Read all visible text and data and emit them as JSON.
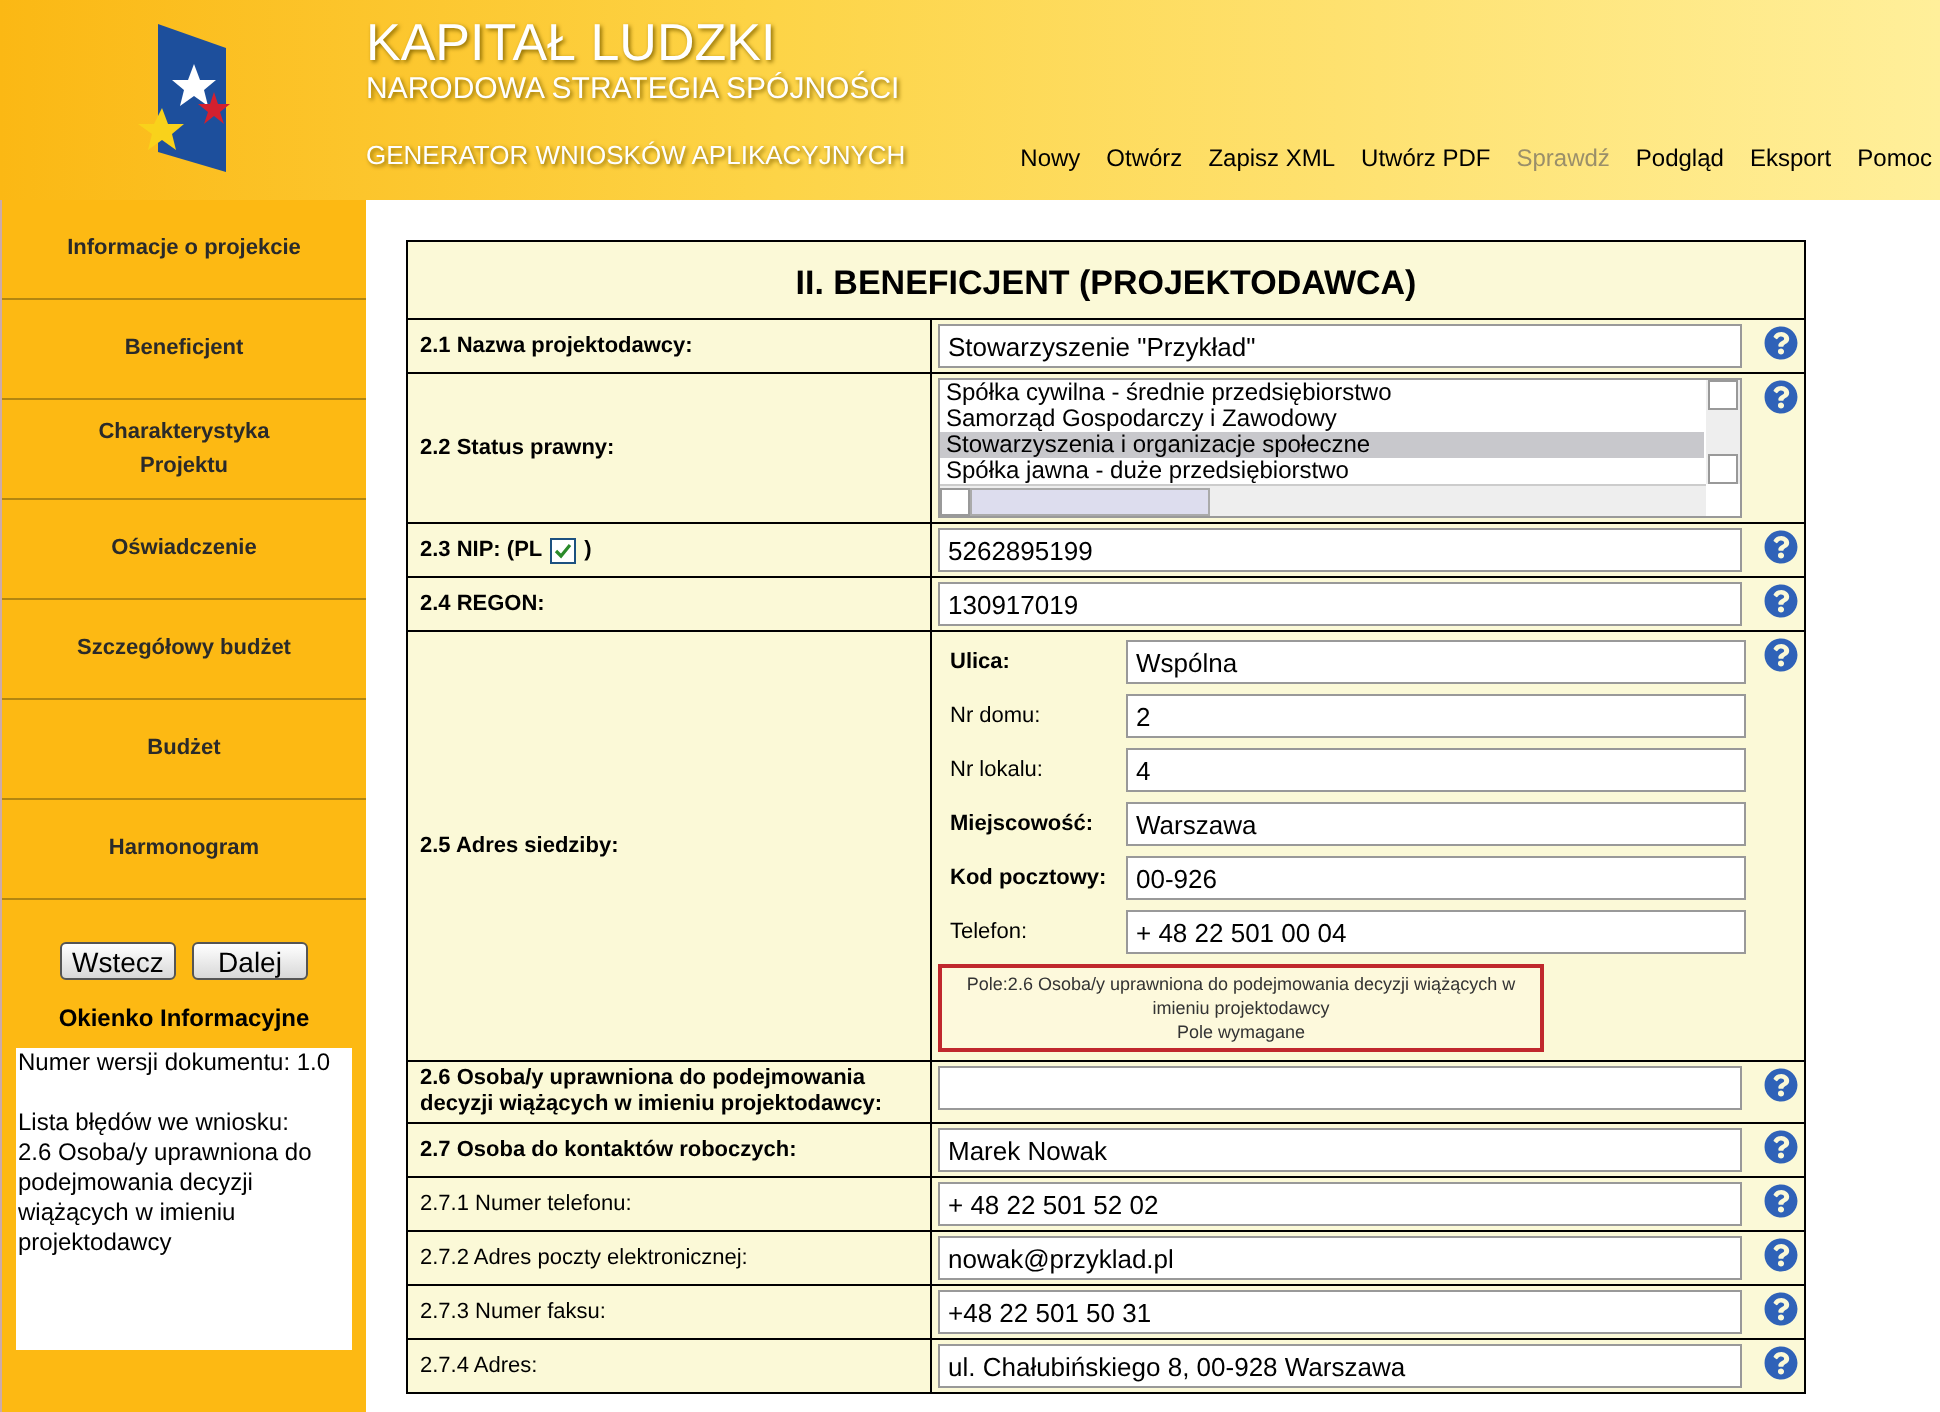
{
  "header": {
    "title": "KAPITAŁ LUDZKI",
    "subtitle": "NARODOWA STRATEGIA SPÓJNOŚCI",
    "generator": "GENERATOR WNIOSKÓW APLIKACYJNYCH",
    "menu": [
      {
        "label": "Nowy",
        "disabled": false
      },
      {
        "label": "Otwórz",
        "disabled": false
      },
      {
        "label": "Zapisz XML",
        "disabled": false
      },
      {
        "label": "Utwórz PDF",
        "disabled": false
      },
      {
        "label": "Sprawdź",
        "disabled": true
      },
      {
        "label": "Podgląd",
        "disabled": false
      },
      {
        "label": "Eksport",
        "disabled": false
      },
      {
        "label": "Pomoc",
        "disabled": false
      }
    ]
  },
  "sidebar": {
    "items": [
      "Informacje o projekcie",
      "Beneficjent",
      "Charakterystyka Projektu",
      "Oświadczenie",
      "Szczegółowy budżet",
      "Budżet",
      "Harmonogram"
    ],
    "buttons": [
      "Wstecz",
      "Dalej"
    ],
    "info_title": "Okienko Informacyjne",
    "info_paragraphs": [
      [
        "Numer wersji dokumentu: 1.0"
      ],
      [
        "Lista błędów we wniosku:",
        "2.6 Osoba/y uprawniona do podejmowania decyzji wiążących w imieniu projektodawcy"
      ]
    ]
  },
  "form": {
    "title": "II. BENEFICJENT (PROJEKTODAWCA)",
    "rows": [
      {
        "kind": "text",
        "label": "2.1 Nazwa projektodawcy:",
        "bold": true,
        "value": "Stowarzyszenie \"Przykład\""
      },
      {
        "kind": "listbox",
        "label": "2.2 Status prawny:",
        "bold": true,
        "options": [
          {
            "label": "Spółka cywilna - średnie przedsiębiorstwo",
            "selected": false
          },
          {
            "label": "Samorząd Gospodarczy i Zawodowy",
            "selected": false
          },
          {
            "label": "Stowarzyszenia i organizacje społeczne",
            "selected": true
          },
          {
            "label": "Spółka jawna - duże przedsiębiorstwo",
            "selected": false
          }
        ]
      },
      {
        "kind": "nip",
        "label": "2.3 NIP: (PL",
        "label_end": ")",
        "checked": true,
        "bold": true,
        "value": "5262895199"
      },
      {
        "kind": "text",
        "label": "2.4 REGON:",
        "bold": true,
        "value": "130917019"
      },
      {
        "kind": "address",
        "label": "2.5 Adres siedziby:",
        "bold": true,
        "fields": [
          {
            "label": "Ulica:",
            "bold": true,
            "value": "Wspólna"
          },
          {
            "label": "Nr domu:",
            "bold": false,
            "value": "2"
          },
          {
            "label": "Nr lokalu:",
            "bold": false,
            "value": "4"
          },
          {
            "label": "Miejscowość:",
            "bold": true,
            "value": "Warszawa"
          },
          {
            "label": "Kod pocztowy:",
            "bold": true,
            "value": "00-926"
          },
          {
            "label": "Telefon:",
            "bold": false,
            "value": "+ 48 22 501 00 04"
          }
        ],
        "tooltip": [
          "Pole:2.6 Osoba/y uprawniona do podejmowania decyzji wiążących w imieniu projektodawcy",
          "Pole wymagane"
        ]
      },
      {
        "kind": "text",
        "label": "2.6 Osoba/y uprawniona do podejmowania decyzji wiążących w imieniu projektodawcy:",
        "bold": true
      },
      {
        "kind": "text",
        "label": "2.7 Osoba do kontaktów roboczych:",
        "bold": true,
        "value": "Marek Nowak"
      },
      {
        "kind": "text",
        "label": "2.7.1 Numer telefonu:",
        "bold": false,
        "value": "+ 48 22 501 52 02"
      },
      {
        "kind": "text",
        "label": "2.7.2 Adres poczty elektronicznej:",
        "bold": false,
        "value": "nowak@przyklad.pl"
      },
      {
        "kind": "text",
        "label": "2.7.3 Numer faksu:",
        "bold": false,
        "value": "+48 22 501 50 31"
      },
      {
        "kind": "text",
        "label": "2.7.4 Adres:",
        "bold": false,
        "value": "ul. Chałubińskiego 8, 00-928 Warszawa"
      }
    ]
  }
}
